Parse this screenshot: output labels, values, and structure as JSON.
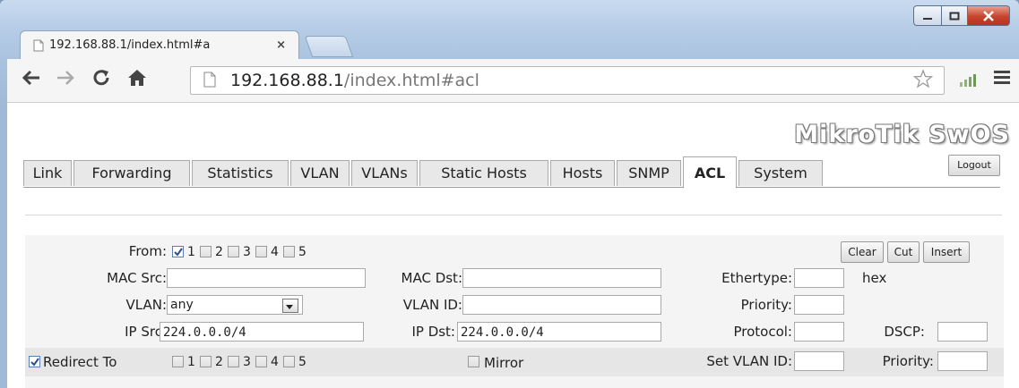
{
  "browser": {
    "tab_title": "192.168.88.1/index.html#a",
    "tab_close": "×",
    "url_host": "192.168.88.1",
    "url_rest": "/index.html#acl"
  },
  "app": {
    "brand": "MikroTik SwOS",
    "logout_label": "Logout",
    "tabs": [
      {
        "label": "Link"
      },
      {
        "label": "Forwarding"
      },
      {
        "label": "Statistics"
      },
      {
        "label": "VLAN"
      },
      {
        "label": "VLANs"
      },
      {
        "label": "Static Hosts"
      },
      {
        "label": "Hosts"
      },
      {
        "label": "SNMP"
      },
      {
        "label": "ACL",
        "active": true
      },
      {
        "label": "System"
      }
    ]
  },
  "acl": {
    "from_label": "From:",
    "ports": [
      "1",
      "2",
      "3",
      "4",
      "5"
    ],
    "from_checked": [
      true,
      false,
      false,
      false,
      false
    ],
    "buttons": {
      "clear": "Clear",
      "cut": "Cut",
      "insert": "Insert"
    },
    "mac_src_label": "MAC Src:",
    "mac_src_value": "",
    "mac_dst_label": "MAC Dst:",
    "mac_dst_value": "",
    "ethertype_label": "Ethertype:",
    "ethertype_value": "",
    "ethertype_unit": "hex",
    "vlan_label": "VLAN:",
    "vlan_value": "any",
    "vlan_id_label": "VLAN ID:",
    "vlan_id_value": "",
    "priority_label": "Priority:",
    "priority_value": "",
    "ip_src_label": "IP Src:",
    "ip_src_value": "224.0.0.0/4",
    "ip_dst_label": "IP Dst:",
    "ip_dst_value": "224.0.0.0/4",
    "protocol_label": "Protocol:",
    "protocol_value": "",
    "dscp_label": "DSCP:",
    "dscp_value": "",
    "redirect_label": "Redirect To",
    "redirect_checked": true,
    "redirect_ports_checked": [
      false,
      false,
      false,
      false,
      false
    ],
    "mirror_label": "Mirror",
    "mirror_checked": false,
    "set_vlan_id_label": "Set VLAN ID:",
    "set_vlan_id_value": "",
    "set_priority_label": "Priority:",
    "set_priority_value": ""
  }
}
